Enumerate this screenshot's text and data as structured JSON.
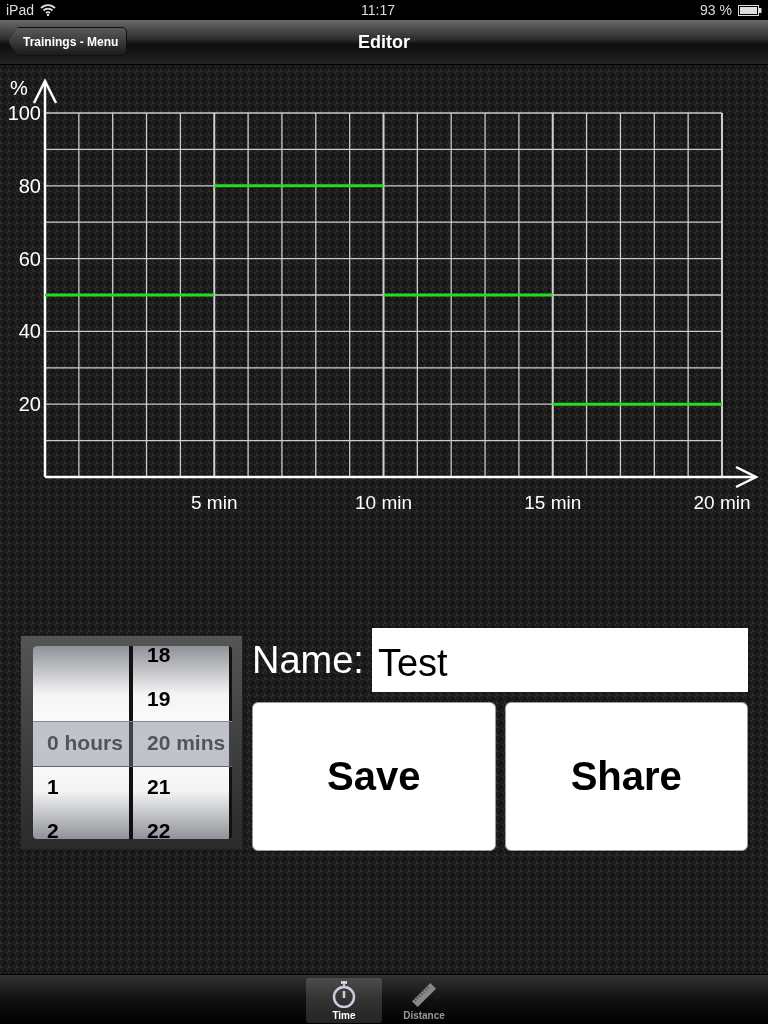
{
  "status_bar": {
    "device": "iPad",
    "time": "11:17",
    "battery": "93 %"
  },
  "nav_bar": {
    "back": "Trainings - Menu",
    "title": "Editor"
  },
  "chart_data": {
    "type": "line",
    "ylabel": "%",
    "x": [
      0,
      5,
      5,
      10,
      10,
      15,
      15,
      20
    ],
    "series": [
      {
        "color": "#22dd22",
        "values": [
          50,
          50,
          80,
          80,
          50,
          50,
          20,
          20
        ]
      }
    ],
    "xlim": [
      0,
      20
    ],
    "ylim": [
      0,
      100
    ],
    "xticks": [
      {
        "value": 5,
        "label": "5 min"
      },
      {
        "value": 10,
        "label": "10 min"
      },
      {
        "value": 15,
        "label": "15 min"
      },
      {
        "value": 20,
        "label": "20 min"
      }
    ],
    "yticks": [
      20,
      40,
      60,
      80,
      100
    ],
    "grid": true
  },
  "picker": {
    "columns": [
      {
        "items": [
          {
            "label": "0 hours",
            "selected": true
          },
          {
            "label": "1",
            "selected": false
          },
          {
            "label": "2",
            "selected": false
          }
        ]
      },
      {
        "items": [
          {
            "label": "18",
            "selected": false
          },
          {
            "label": "19",
            "selected": false
          },
          {
            "label": "20 mins",
            "selected": true
          },
          {
            "label": "21",
            "selected": false
          },
          {
            "label": "22",
            "selected": false
          }
        ]
      }
    ]
  },
  "name_field": {
    "label": "Name:",
    "value": "Test"
  },
  "buttons": [
    "Save",
    "Share"
  ],
  "tab_bar": [
    {
      "label": "Time",
      "kind": "stopwatch",
      "selected": true
    },
    {
      "label": "Distance",
      "kind": "ruler",
      "selected": false
    }
  ]
}
